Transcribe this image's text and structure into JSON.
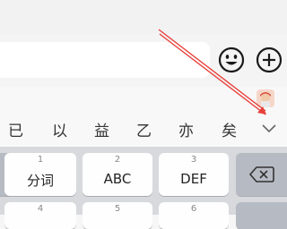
{
  "input": {
    "emoji_icon": "emoji-icon",
    "plus_icon": "plus-icon"
  },
  "candidates": [
    "已",
    "以",
    "益",
    "乙",
    "亦",
    "矣"
  ],
  "keyboard": {
    "row1": [
      {
        "num": "1",
        "label": "分词"
      },
      {
        "num": "2",
        "label": "ABC"
      },
      {
        "num": "3",
        "label": "DEF"
      }
    ],
    "row2_nums": [
      "4",
      "5",
      "6"
    ],
    "backspace_icon": "backspace-icon"
  },
  "colors": {
    "annotation_arrow": "#e8403a"
  }
}
